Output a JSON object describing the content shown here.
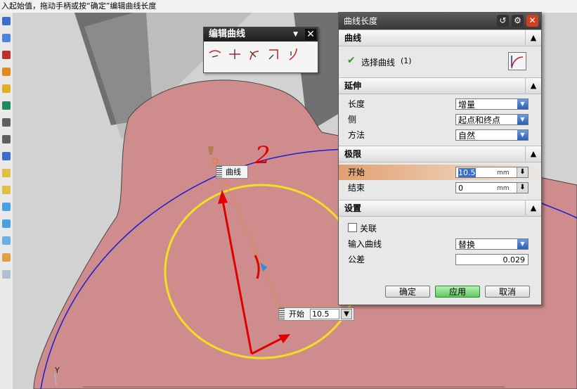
{
  "status_text": "入起始值，拖动手柄或按“确定”编辑曲线长度",
  "palette": {
    "title": "编辑曲线",
    "tools": [
      "trim-curve-icon",
      "split-curve-icon",
      "fillet-curve-icon",
      "corner-curve-icon",
      "length-curve-icon"
    ]
  },
  "dialog": {
    "title": "曲线长度",
    "sections": {
      "curve": {
        "header": "曲线",
        "select_label": "选择曲线",
        "select_count": "(1)"
      },
      "extend": {
        "header": "延伸",
        "length_label": "长度",
        "length_value": "增量",
        "side_label": "侧",
        "side_value": "起点和终点",
        "method_label": "方法",
        "method_value": "自然"
      },
      "limits": {
        "header": "极限",
        "start_label": "开始",
        "start_value": "10.5",
        "end_label": "结束",
        "end_value": "0",
        "unit": "mm"
      },
      "settings": {
        "header": "设置",
        "assoc_label": "关联",
        "input_curve_label": "输入曲线",
        "input_curve_value": "替换",
        "tolerance_label": "公差",
        "tolerance_value": "0.029"
      }
    },
    "buttons": {
      "ok": "确定",
      "apply": "应用",
      "cancel": "取消"
    }
  },
  "viewport": {
    "curve_tag": "曲线",
    "start_tag_label": "开始",
    "start_tag_value": "10.5",
    "annotation_number": "2",
    "axis_label": "Y"
  },
  "colors": {
    "part": "#d08a8a",
    "curve": "#1c1cd6",
    "annotation": "#e00000",
    "highlight_circle": "#f0e020"
  }
}
